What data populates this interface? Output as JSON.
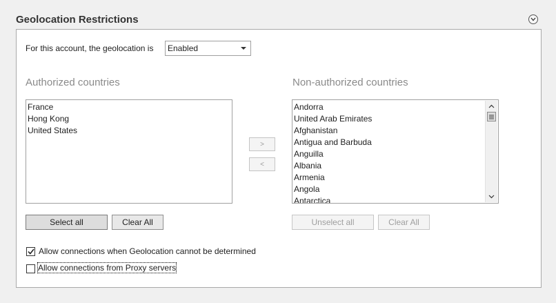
{
  "section": {
    "title": "Geolocation Restrictions",
    "collapse_icon": "chevron-down-circle-icon"
  },
  "geolocation": {
    "label": "For this account, the geolocation is",
    "value": "Enabled"
  },
  "authorized": {
    "title": "Authorized countries",
    "items": [
      "France",
      "Hong Kong",
      "United States"
    ],
    "select_all_label": "Select all",
    "clear_all_label": "Clear All"
  },
  "move_buttons": {
    "add_label": ">",
    "remove_label": "<"
  },
  "non_authorized": {
    "title": "Non-authorized countries",
    "items": [
      "Andorra",
      "United Arab Emirates",
      "Afghanistan",
      "Antigua and Barbuda",
      "Anguilla",
      "Albania",
      "Armenia",
      "Angola",
      "Antarctica"
    ],
    "unselect_all_label": "Unselect all",
    "clear_all_label": "Clear All"
  },
  "options": {
    "allow_undetermined": {
      "label": "Allow connections when Geolocation cannot be determined",
      "checked": true
    },
    "allow_proxy": {
      "label": "Allow connections from Proxy servers",
      "checked": false
    }
  }
}
